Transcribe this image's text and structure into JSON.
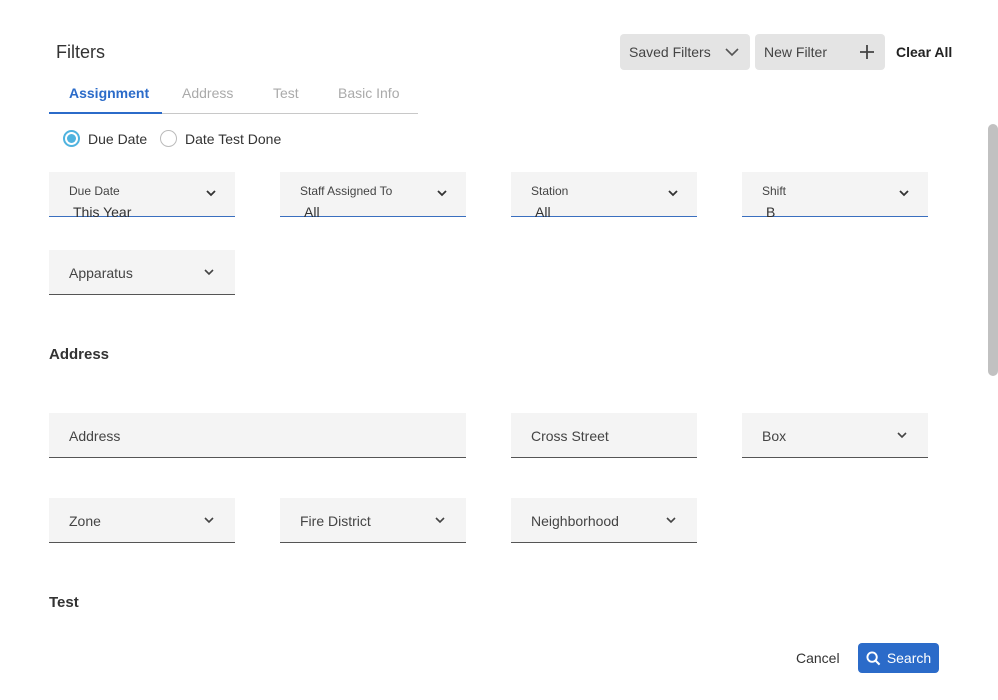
{
  "header": {
    "title": "Filters",
    "saved_filters_label": "Saved Filters",
    "new_filter_label": "New Filter",
    "clear_all_label": "Clear All"
  },
  "tabs": [
    {
      "label": "Assignment",
      "active": true
    },
    {
      "label": "Address",
      "active": false
    },
    {
      "label": "Test",
      "active": false
    },
    {
      "label": "Basic Info",
      "active": false
    }
  ],
  "date_type": {
    "options": [
      {
        "label": "Due Date",
        "checked": true
      },
      {
        "label": "Date Test Done",
        "checked": false
      }
    ]
  },
  "assignment": {
    "due_date": {
      "label": "Due Date",
      "value": "This Year"
    },
    "staff": {
      "label": "Staff Assigned To",
      "value": "All"
    },
    "station": {
      "label": "Station",
      "value": "All"
    },
    "shift": {
      "label": "Shift",
      "value": "B"
    },
    "apparatus": {
      "placeholder": "Apparatus"
    }
  },
  "address_section": {
    "title": "Address",
    "address": {
      "placeholder": "Address"
    },
    "cross_street": {
      "placeholder": "Cross Street"
    },
    "box": {
      "placeholder": "Box"
    },
    "zone": {
      "placeholder": "Zone"
    },
    "fire_district": {
      "placeholder": "Fire District"
    },
    "neighborhood": {
      "placeholder": "Neighborhood"
    }
  },
  "test_section": {
    "title": "Test"
  },
  "footer": {
    "cancel_label": "Cancel",
    "search_label": "Search"
  },
  "colors": {
    "accent": "#2b6bc9",
    "radio": "#4fb3df",
    "field_bg": "#f4f4f4",
    "button_bg": "#e4e4e4"
  }
}
